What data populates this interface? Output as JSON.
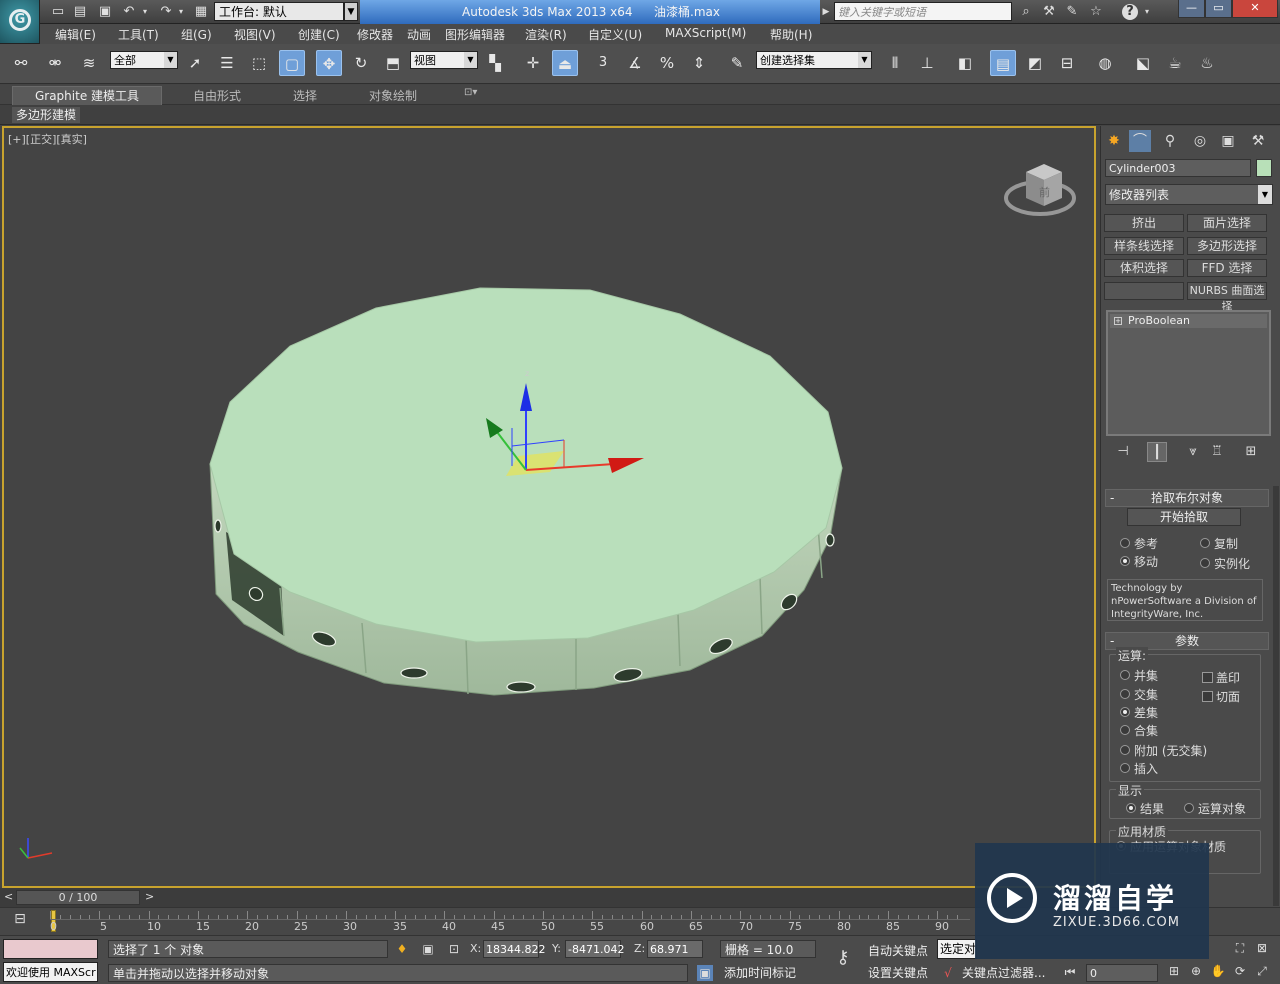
{
  "titlebar": {
    "workspace_label": "工作台: 默认",
    "app_name": "Autodesk 3ds Max  2013 x64",
    "file_name": "油漆桶.max",
    "search_placeholder": "键入关键字或短语",
    "win_minimize": "—",
    "win_restore": "▭",
    "win_close": "✕"
  },
  "menubar": {
    "items": [
      "编辑(E)",
      "工具(T)",
      "组(G)",
      "视图(V)",
      "创建(C)",
      "修改器",
      "动画",
      "图形编辑器",
      "渲染(R)",
      "自定义(U)",
      "MAXScript(M)",
      "帮助(H)"
    ]
  },
  "toolbar": {
    "filter_value": "全部",
    "refcoord_value": "视图",
    "snap_3d": "3",
    "named_selset_value": "创建选择集"
  },
  "ribbon": {
    "tabs": [
      "Graphite 建模工具",
      "自由形式",
      "选择",
      "对象绘制"
    ],
    "sub_label": "多边形建模"
  },
  "viewport": {
    "label": "[+][正交][真实]",
    "viewcube_face": "前",
    "axis_z": "z"
  },
  "command_panel": {
    "object_name": "Cylinder003",
    "object_color": "#b8e0b8",
    "modifier_list": "修改器列表",
    "modifier_buttons": [
      "挤出",
      "面片选择",
      "样条线选择",
      "多边形选择",
      "体积选择",
      "FFD 选择",
      "",
      "NURBS 曲面选择"
    ],
    "stack_item": "ProBoolean",
    "pick_rollout": "拾取布尔对象",
    "pick_button": "开始拾取",
    "pick_options": [
      "参考",
      "复制",
      "移动",
      "实例化"
    ],
    "credit": "Technology by nPowerSoftware a Division of IntegrityWare, Inc.",
    "params_rollout": "参数",
    "operation_title": "运算:",
    "operations": [
      "并集",
      "交集",
      "差集",
      "合集",
      "附加 (无交集)",
      "插入"
    ],
    "imprint": "盖印",
    "cookie": "切面",
    "display_title": "显示",
    "display_options": [
      "结果",
      "运算对象"
    ],
    "material_title": "应用材质",
    "material_option": "应用运算对象材质",
    "rollout_minus": "-"
  },
  "timeline": {
    "frame_display": "0 / 100",
    "prev": "<",
    "next": ">",
    "ticks": [
      "0",
      "5",
      "10",
      "15",
      "20",
      "25",
      "30",
      "35",
      "40",
      "45",
      "50",
      "55",
      "60",
      "65",
      "70",
      "75",
      "80",
      "85",
      "90"
    ]
  },
  "statusbar": {
    "welcome": "欢迎使用 MAXScr",
    "selection_msg": "选择了 1 个 对象",
    "hint_msg": "单击并拖动以选择并移动对象",
    "x_label": "X:",
    "x_value": "18344.822",
    "y_label": "Y:",
    "y_value": "-8471.042",
    "z_label": "Z:",
    "z_value": "68.971",
    "grid": "栅格 = 10.0",
    "add_time_tag": "添加时间标记",
    "auto_key": "自动关键点",
    "set_key": "设置关键点",
    "selected_combo": "选定对象",
    "key_filters": "关键点过滤器...",
    "frame_value": "0"
  },
  "watermark": {
    "title": "溜溜自学",
    "url": "ZIXUE.3D66.COM"
  }
}
